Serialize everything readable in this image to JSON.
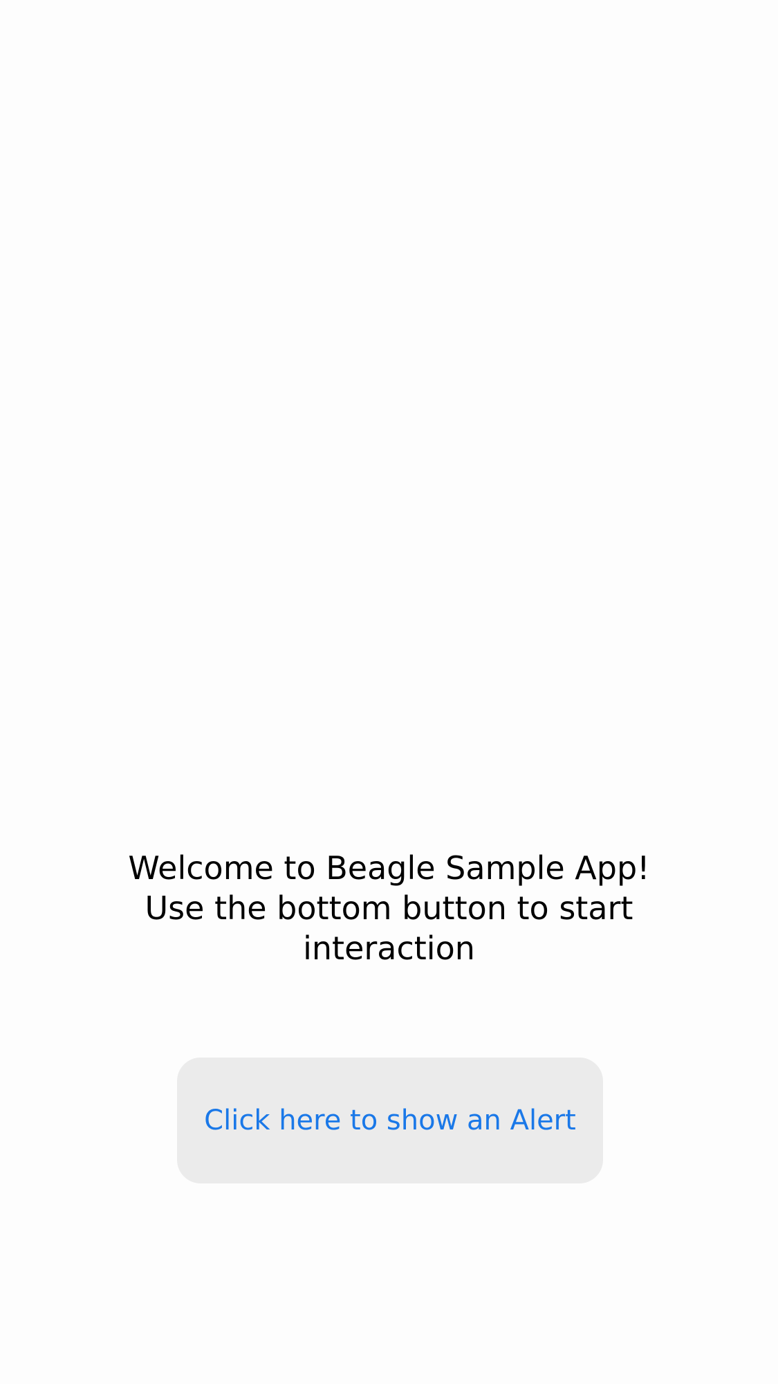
{
  "welcome": {
    "line1": "Welcome to Beagle Sample App!",
    "line2": "Use the bottom button to start",
    "line3": "interaction"
  },
  "alert_button": {
    "label": "Click here to show an Alert",
    "text_color": "#1a78e8",
    "background_color": "#ebebeb"
  }
}
